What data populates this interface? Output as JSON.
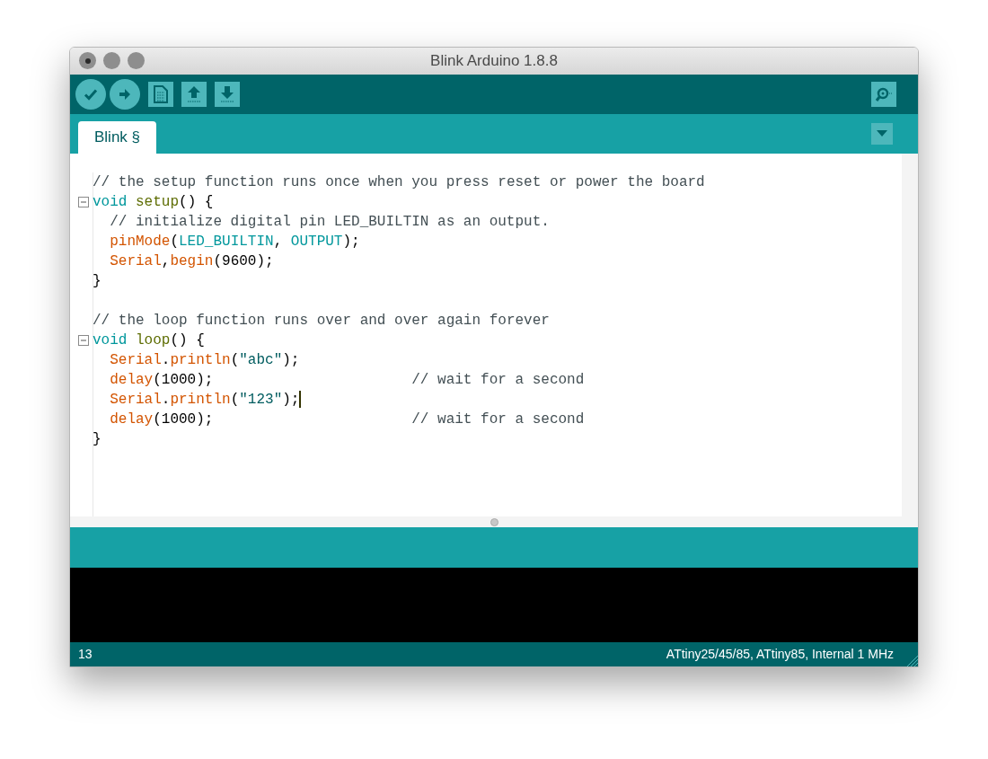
{
  "window": {
    "title": "Blink Arduino 1.8.8"
  },
  "tabs": [
    {
      "label": "Blink §",
      "selected": true
    }
  ],
  "editor": {
    "lines": [
      {
        "kind": "code",
        "tokens": [
          {
            "kind": "comment",
            "text": "// the setup function runs once when you press reset or power the board"
          }
        ]
      },
      {
        "kind": "code",
        "foldable": true,
        "tokens": [
          {
            "kind": "keyword",
            "text": "void "
          },
          {
            "kind": "function",
            "text": "setup"
          },
          {
            "kind": "plain",
            "text": "() {"
          }
        ]
      },
      {
        "kind": "code",
        "indented": true,
        "tokens": [
          {
            "kind": "comment",
            "text": "// initialize digital pin LED_BUILTIN as an output."
          }
        ]
      },
      {
        "kind": "code",
        "indented": true,
        "tokens": [
          {
            "kind": "builtin",
            "text": "pinMode"
          },
          {
            "kind": "plain",
            "text": "("
          },
          {
            "kind": "constant",
            "text": "LED_BUILTIN"
          },
          {
            "kind": "plain",
            "text": ", "
          },
          {
            "kind": "constant",
            "text": "OUTPUT"
          },
          {
            "kind": "plain",
            "text": ");"
          }
        ]
      },
      {
        "kind": "code",
        "indented": true,
        "tokens": [
          {
            "kind": "builtin",
            "text": "Serial"
          },
          {
            "kind": "plain",
            "text": ","
          },
          {
            "kind": "builtin",
            "text": "begin"
          },
          {
            "kind": "plain",
            "text": "(9600);"
          }
        ]
      },
      {
        "kind": "code",
        "tokens": [
          {
            "kind": "plain",
            "text": "}"
          }
        ]
      },
      {
        "kind": "blank"
      },
      {
        "kind": "code",
        "tokens": [
          {
            "kind": "comment",
            "text": "// the loop function runs over and over again forever"
          }
        ]
      },
      {
        "kind": "code",
        "foldable": true,
        "tokens": [
          {
            "kind": "keyword",
            "text": "void "
          },
          {
            "kind": "function",
            "text": "loop"
          },
          {
            "kind": "plain",
            "text": "() {"
          }
        ]
      },
      {
        "kind": "code",
        "indented": true,
        "tokens": [
          {
            "kind": "builtin",
            "text": "Serial"
          },
          {
            "kind": "plain",
            "text": "."
          },
          {
            "kind": "builtin",
            "text": "println"
          },
          {
            "kind": "plain",
            "text": "("
          },
          {
            "kind": "string",
            "text": "\"abc\""
          },
          {
            "kind": "plain",
            "text": ");"
          }
        ]
      },
      {
        "kind": "code",
        "indented": true,
        "tokens": [
          {
            "kind": "builtin",
            "text": "delay"
          },
          {
            "kind": "plain",
            "text": "(1000);                       "
          },
          {
            "kind": "comment",
            "text": "// wait for a second"
          }
        ]
      },
      {
        "kind": "code",
        "indented": true,
        "caret": true,
        "tokens": [
          {
            "kind": "builtin",
            "text": "Serial"
          },
          {
            "kind": "plain",
            "text": "."
          },
          {
            "kind": "builtin",
            "text": "println"
          },
          {
            "kind": "plain",
            "text": "("
          },
          {
            "kind": "string",
            "text": "\"123\""
          },
          {
            "kind": "plain",
            "text": ");"
          }
        ]
      },
      {
        "kind": "code",
        "indented": true,
        "tokens": [
          {
            "kind": "builtin",
            "text": "delay"
          },
          {
            "kind": "plain",
            "text": "(1000);                       "
          },
          {
            "kind": "comment",
            "text": "// wait for a second"
          }
        ]
      },
      {
        "kind": "code",
        "tokens": [
          {
            "kind": "plain",
            "text": "}"
          }
        ]
      }
    ]
  },
  "status_bar": {
    "line": "13",
    "board": "ATtiny25/45/85, ATtiny85, Internal 1 MHz"
  }
}
